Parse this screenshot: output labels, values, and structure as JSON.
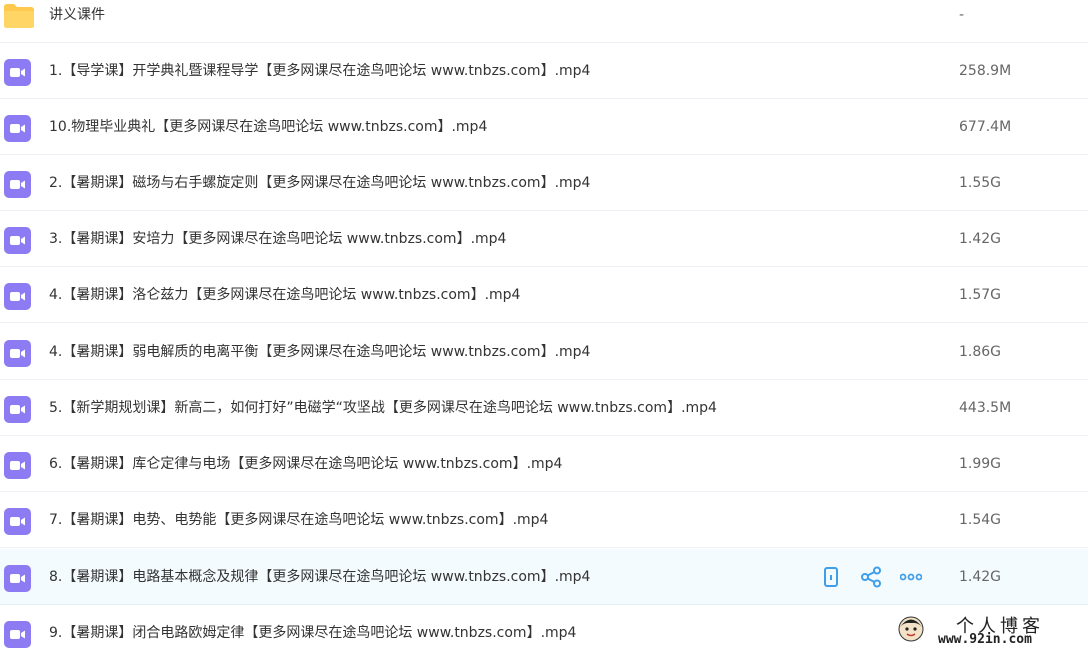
{
  "colors": {
    "video_icon": "#8c7bf3",
    "folder_icon": "#ffc94d",
    "action_icon": "#3f9ee8",
    "hover_row": "#f4fbff"
  },
  "files": [
    {
      "type": "folder",
      "icon": "folder-icon",
      "name": "讲义课件",
      "size": "-"
    },
    {
      "type": "video",
      "icon": "video-file-icon",
      "name": "1.【导学课】开学典礼暨课程导学【更多网课尽在途鸟吧论坛 www.tnbzs.com】.mp4",
      "size": "258.9M"
    },
    {
      "type": "video",
      "icon": "video-file-icon",
      "name": "10.物理毕业典礼【更多网课尽在途鸟吧论坛 www.tnbzs.com】.mp4",
      "size": "677.4M"
    },
    {
      "type": "video",
      "icon": "video-file-icon",
      "name": "2.【暑期课】磁场与右手螺旋定则【更多网课尽在途鸟吧论坛 www.tnbzs.com】.mp4",
      "size": "1.55G"
    },
    {
      "type": "video",
      "icon": "video-file-icon",
      "name": "3.【暑期课】安培力【更多网课尽在途鸟吧论坛 www.tnbzs.com】.mp4",
      "size": "1.42G"
    },
    {
      "type": "video",
      "icon": "video-file-icon",
      "name": "4.【暑期课】洛仑兹力【更多网课尽在途鸟吧论坛 www.tnbzs.com】.mp4",
      "size": "1.57G"
    },
    {
      "type": "video",
      "icon": "video-file-icon",
      "name": "4.【暑期课】弱电解质的电离平衡【更多网课尽在途鸟吧论坛 www.tnbzs.com】.mp4",
      "size": "1.86G"
    },
    {
      "type": "video",
      "icon": "video-file-icon",
      "name": "5.【新学期规划课】新高二，如何打好”电磁学“攻坚战【更多网课尽在途鸟吧论坛 www.tnbzs.com】.mp4",
      "size": "443.5M"
    },
    {
      "type": "video",
      "icon": "video-file-icon",
      "name": "6.【暑期课】库仑定律与电场【更多网课尽在途鸟吧论坛 www.tnbzs.com】.mp4",
      "size": "1.99G"
    },
    {
      "type": "video",
      "icon": "video-file-icon",
      "name": "7.【暑期课】电势、电势能【更多网课尽在途鸟吧论坛 www.tnbzs.com】.mp4",
      "size": "1.54G"
    },
    {
      "type": "video",
      "icon": "video-file-icon",
      "name": "8.【暑期课】电路基本概念及规律【更多网课尽在途鸟吧论坛 www.tnbzs.com】.mp4",
      "size": "1.42G",
      "hovered": true
    },
    {
      "type": "video",
      "icon": "video-file-icon",
      "name": "9.【暑期课】闭合电路欧姆定律【更多网课尽在途鸟吧论坛 www.tnbzs.com】.mp4",
      "size": "1.42G"
    }
  ],
  "hover_actions": [
    {
      "icon": "phone-icon"
    },
    {
      "icon": "share-icon"
    },
    {
      "icon": "more-icon"
    }
  ],
  "watermark": {
    "title": "个人博客",
    "url": "www.92in.com",
    "avatar_icon": "avatar-icon"
  }
}
